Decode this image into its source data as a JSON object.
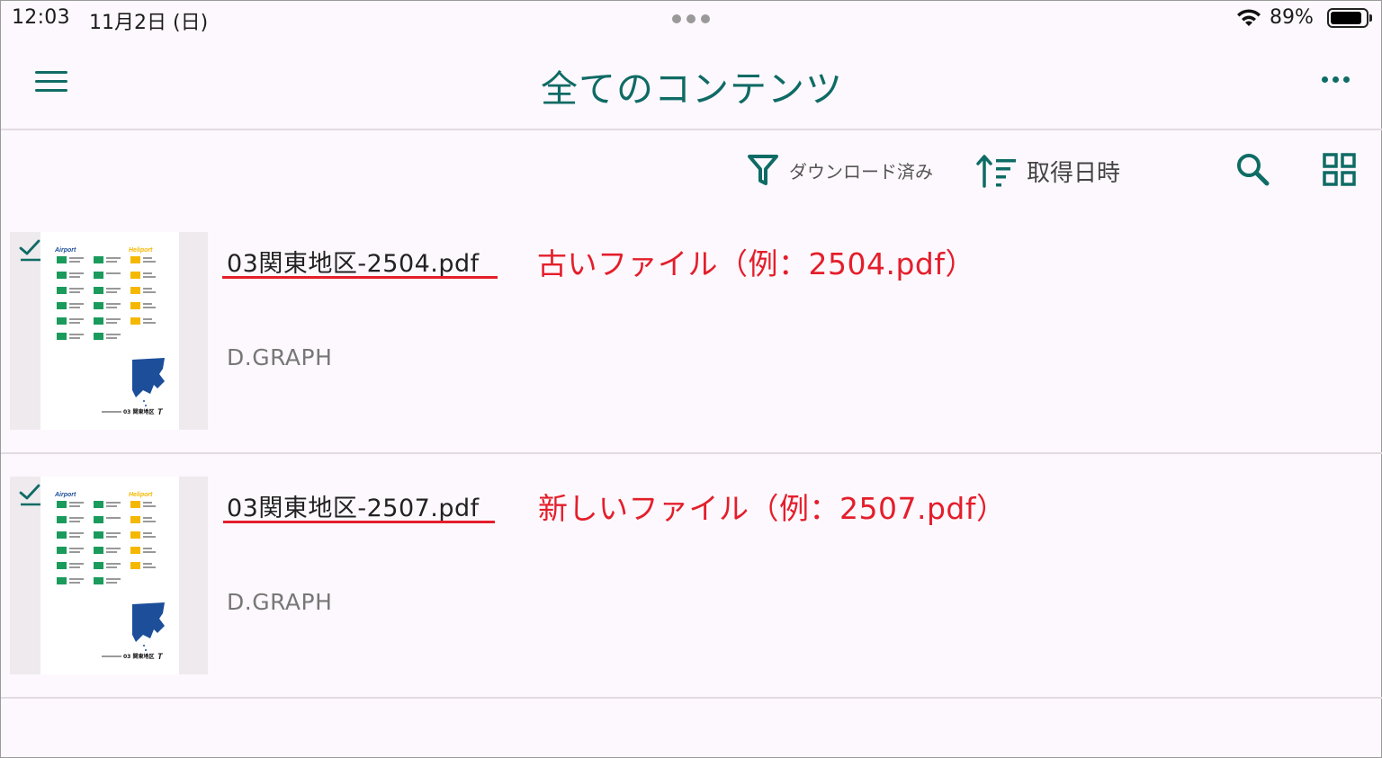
{
  "status_bar": {
    "time": "12:03",
    "date": "11月2日 (日)",
    "battery_percent": "89%",
    "battery_level": 0.89
  },
  "header": {
    "title": "全てのコンテンツ",
    "menu_icon": "hamburger-menu-icon",
    "more_icon": "more-horizontal-icon"
  },
  "toolbar": {
    "filter_label": "ダウンロード済み",
    "filter_icon": "filter-funnel-icon",
    "sort_label": "取得日時",
    "sort_icon": "sort-ascending-icon",
    "search_icon": "search-icon",
    "view_icon": "grid-view-icon"
  },
  "items": [
    {
      "filename": "03関東地区-2504.pdf",
      "publisher": "D.GRAPH",
      "annotation": "古いファイル（例：2504.pdf）",
      "downloaded": true
    },
    {
      "filename": "03関東地区-2507.pdf",
      "publisher": "D.GRAPH",
      "annotation": "新しいファイル（例：2507.pdf）",
      "downloaded": true
    }
  ],
  "thumbnail": {
    "left_heading": "Airport",
    "right_heading": "Heliport",
    "footer": "03 関東地区",
    "footer_mark": "T"
  },
  "colors": {
    "accent": "#0f6b65",
    "annotation_red": "#e41e2b",
    "background": "#fdf8fd",
    "thumb_green": "#1a9b5c",
    "thumb_yellow": "#f5b800",
    "thumb_blue": "#1c4e9a"
  }
}
